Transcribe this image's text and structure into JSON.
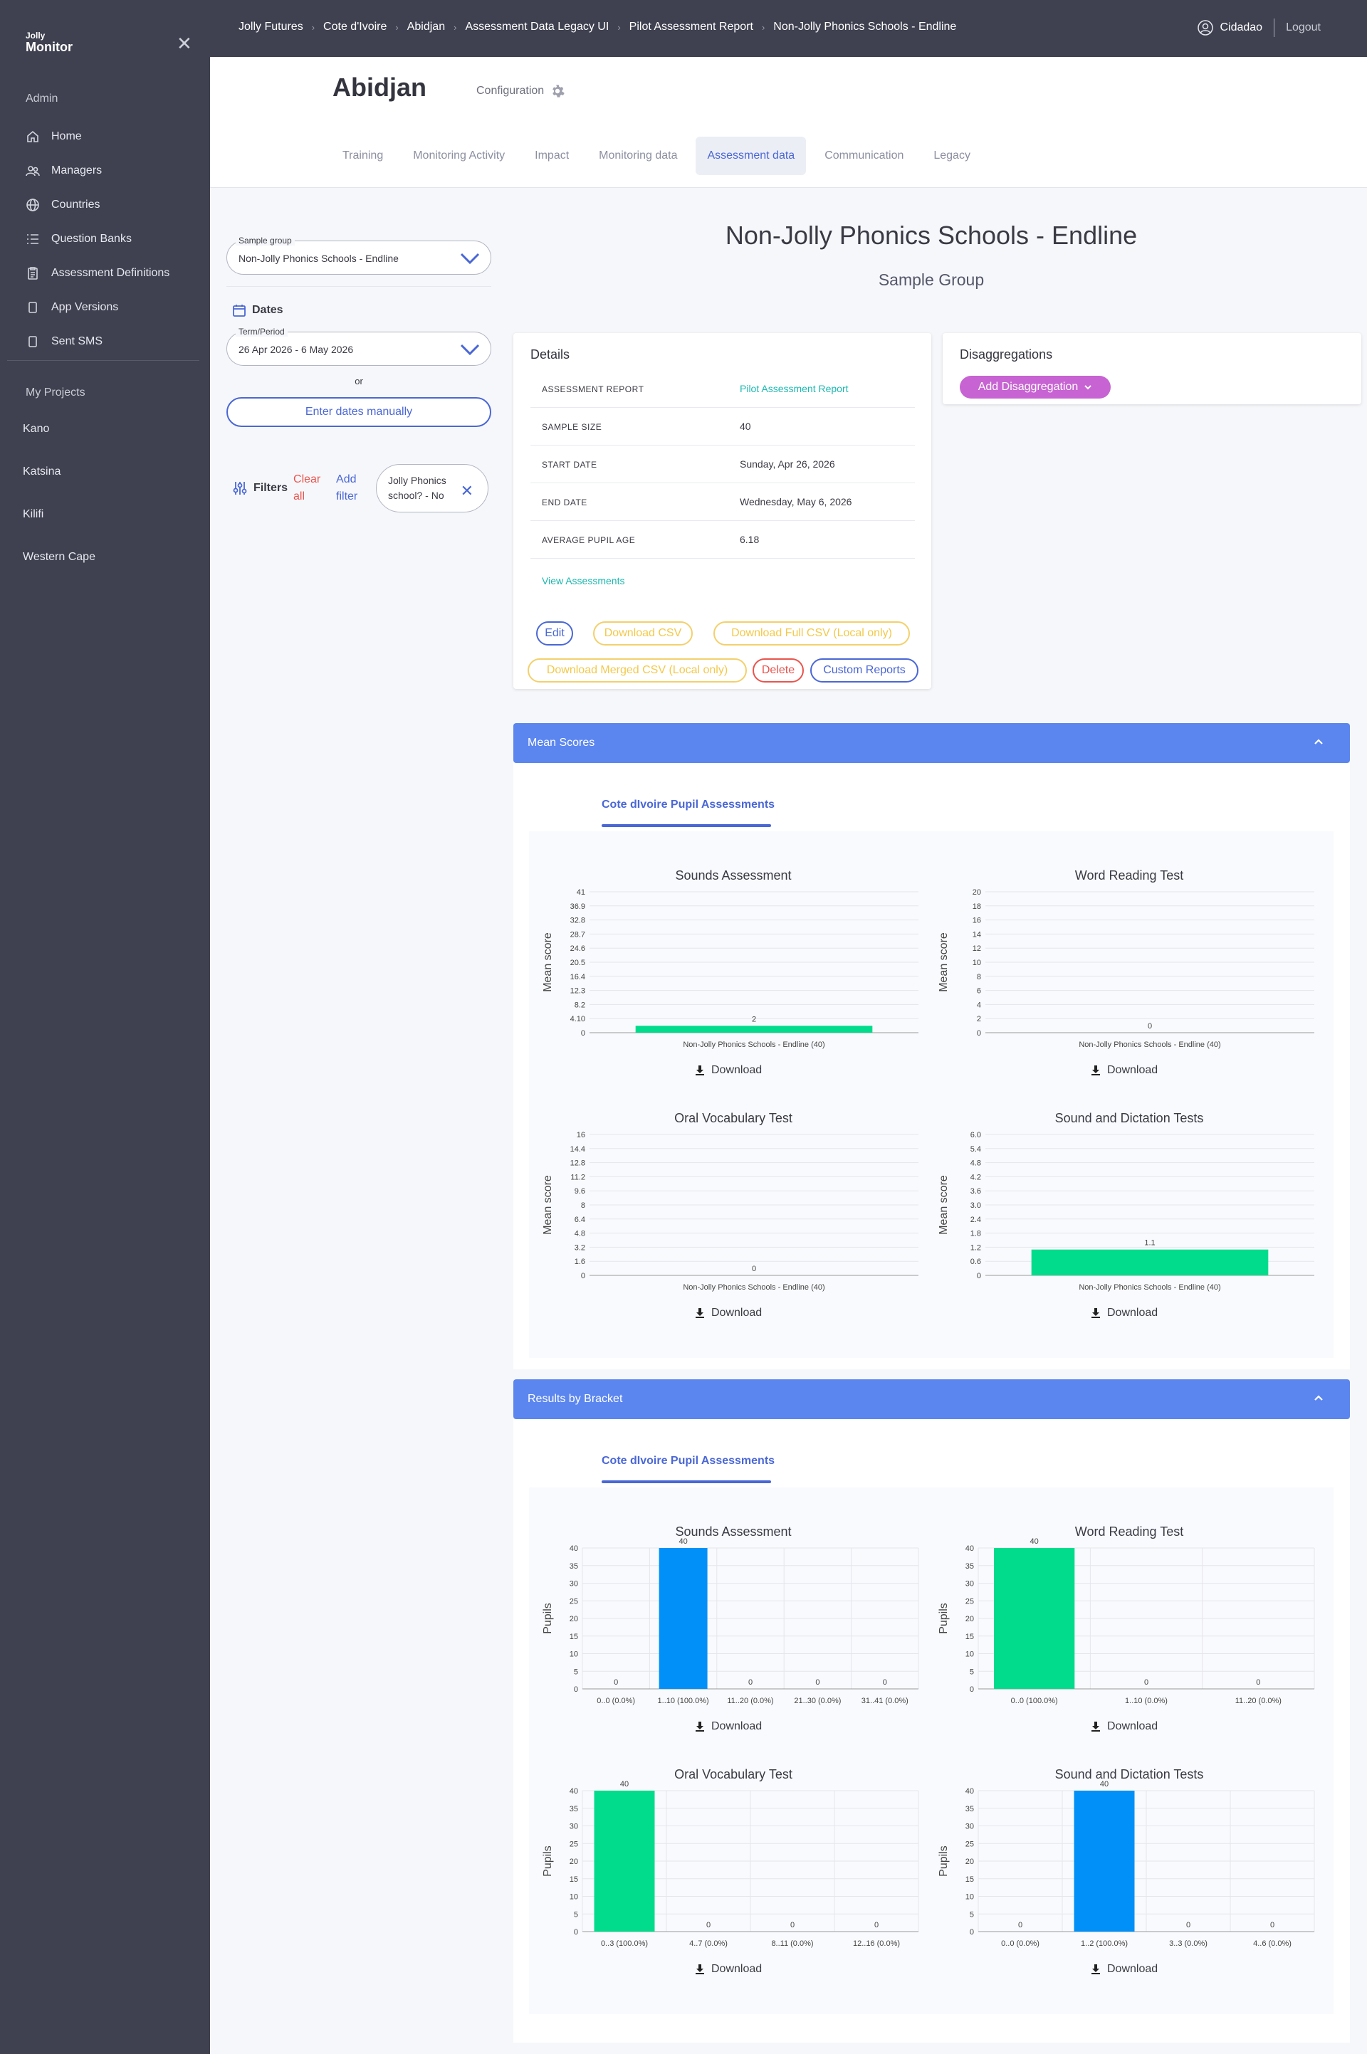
{
  "sidebar": {
    "logo_top": "Jolly",
    "logo_bottom": "Monitor",
    "admin_label": "Admin",
    "items": [
      {
        "label": "Home",
        "icon": "home-icon"
      },
      {
        "label": "Managers",
        "icon": "users-icon"
      },
      {
        "label": "Countries",
        "icon": "globe-icon"
      },
      {
        "label": "Question Banks",
        "icon": "list-icon"
      },
      {
        "label": "Assessment Definitions",
        "icon": "clipboard-icon"
      },
      {
        "label": "App Versions",
        "icon": "device-icon"
      },
      {
        "label": "Sent SMS",
        "icon": "device-icon"
      }
    ],
    "projects_label": "My Projects",
    "projects": [
      "Kano",
      "Katsina",
      "Kilifi",
      "Western Cape"
    ]
  },
  "topbar": {
    "breadcrumbs": [
      "Jolly Futures",
      "Cote d'Ivoire",
      "Abidjan",
      "Assessment Data Legacy UI",
      "Pilot Assessment Report",
      "Non-Jolly Phonics Schools - Endline"
    ],
    "user": "Cidadao",
    "logout": "Logout"
  },
  "header": {
    "city": "Abidjan",
    "config": "Configuration",
    "tabs": [
      "Training",
      "Monitoring Activity",
      "Impact",
      "Monitoring data",
      "Assessment data",
      "Communication",
      "Legacy"
    ],
    "active_tab": "Assessment data"
  },
  "filters": {
    "sample_group_label": "Sample group",
    "sample_group_value": "Non-Jolly Phonics Schools - Endline",
    "dates_title": "Dates",
    "term_label": "Term/Period",
    "term_value": "26 Apr 2026 - 6 May 2026",
    "or": "or",
    "manual_btn": "Enter dates manually",
    "filters_title": "Filters",
    "clear_all": "Clear all",
    "add_filter": "Add filter",
    "chip": "Jolly Phonics school? - No"
  },
  "main": {
    "title": "Non-Jolly Phonics Schools - Endline",
    "subtitle": "Sample Group"
  },
  "details": {
    "title": "Details",
    "rows": [
      {
        "key": "Assessment report",
        "value": "Pilot Assessment Report"
      },
      {
        "key": "Sample size",
        "value": "40"
      },
      {
        "key": "Start date",
        "value": "Sunday, Apr 26, 2026"
      },
      {
        "key": "End date",
        "value": "Wednesday, May 6, 2026"
      },
      {
        "key": "Average pupil age",
        "value": "6.18"
      }
    ],
    "view_assessments": "View Assessments",
    "buttons": {
      "edit": "Edit",
      "download_csv": "Download CSV",
      "download_full": "Download Full CSV (Local only)",
      "download_merged": "Download Merged CSV (Local only)",
      "delete": "Delete",
      "custom_reports": "Custom Reports"
    }
  },
  "disaggregations": {
    "title": "Disaggregations",
    "add_btn": "Add Disaggregation"
  },
  "mean_scores": {
    "bar_title": "Mean Scores",
    "subtab": "Cote dIvoire Pupil Assessments",
    "download": "Download"
  },
  "brackets": {
    "bar_title": "Results by Bracket",
    "subtab": "Cote dIvoire Pupil Assessments",
    "download": "Download"
  },
  "colors": {
    "green": "#00dc8c",
    "blue": "#0090f8",
    "accent": "#5b86f0",
    "sidebar": "#3f4150"
  },
  "chart_data": [
    {
      "type": "bar",
      "title": "Sounds Assessment",
      "ylabel": "Mean score",
      "categories": [
        "Non-Jolly Phonics Schools - Endline (40)"
      ],
      "values": [
        2
      ],
      "labels": [
        "2"
      ],
      "yticks": [
        "0",
        "4.10",
        "8.2",
        "12.3",
        "16.4",
        "20.5",
        "24.6",
        "28.7",
        "32.8",
        "36.9",
        "41"
      ],
      "ylim": [
        0,
        41
      ],
      "colors": [
        "#00dc8c"
      ]
    },
    {
      "type": "bar",
      "title": "Word Reading Test",
      "ylabel": "Mean score",
      "categories": [
        "Non-Jolly Phonics Schools - Endline (40)"
      ],
      "values": [
        0
      ],
      "labels": [
        "0"
      ],
      "yticks": [
        "0",
        "2",
        "4",
        "6",
        "8",
        "10",
        "12",
        "14",
        "16",
        "18",
        "20"
      ],
      "ylim": [
        0,
        20
      ],
      "colors": [
        "#00dc8c"
      ]
    },
    {
      "type": "bar",
      "title": "Oral Vocabulary Test",
      "ylabel": "Mean score",
      "categories": [
        "Non-Jolly Phonics Schools - Endline (40)"
      ],
      "values": [
        0
      ],
      "labels": [
        "0"
      ],
      "yticks": [
        "0",
        "1.6",
        "3.2",
        "4.8",
        "6.4",
        "8",
        "9.6",
        "11.2",
        "12.8",
        "14.4",
        "16"
      ],
      "ylim": [
        0,
        16
      ],
      "colors": [
        "#00dc8c"
      ]
    },
    {
      "type": "bar",
      "title": "Sound and Dictation Tests",
      "ylabel": "Mean score",
      "categories": [
        "Non-Jolly Phonics Schools - Endline (40)"
      ],
      "values": [
        1.1
      ],
      "labels": [
        "1.1"
      ],
      "yticks": [
        "0",
        "0.6",
        "1.2",
        "1.8",
        "2.4",
        "3.0",
        "3.6",
        "4.2",
        "4.8",
        "5.4",
        "6.0"
      ],
      "ylim": [
        0,
        6
      ],
      "colors": [
        "#00dc8c"
      ]
    },
    {
      "type": "bar",
      "title": "Sounds Assessment",
      "ylabel": "Pupils",
      "categories": [
        "0..0 (0.0%)",
        "1..10 (100.0%)",
        "11..20 (0.0%)",
        "21..30 (0.0%)",
        "31..41 (0.0%)"
      ],
      "values": [
        0,
        40,
        0,
        0,
        0
      ],
      "labels": [
        "0",
        "40",
        "0",
        "0",
        "0"
      ],
      "yticks": [
        "0",
        "5",
        "10",
        "15",
        "20",
        "25",
        "30",
        "35",
        "40"
      ],
      "ylim": [
        0,
        40
      ],
      "colors": [
        "#0090f8",
        "#0090f8",
        "#0090f8",
        "#0090f8",
        "#0090f8"
      ]
    },
    {
      "type": "bar",
      "title": "Word Reading Test",
      "ylabel": "Pupils",
      "categories": [
        "0..0 (100.0%)",
        "1..10 (0.0%)",
        "11..20 (0.0%)"
      ],
      "values": [
        40,
        0,
        0
      ],
      "labels": [
        "40",
        "0",
        "0"
      ],
      "yticks": [
        "0",
        "5",
        "10",
        "15",
        "20",
        "25",
        "30",
        "35",
        "40"
      ],
      "ylim": [
        0,
        40
      ],
      "colors": [
        "#00dc8c",
        "#00dc8c",
        "#00dc8c"
      ]
    },
    {
      "type": "bar",
      "title": "Oral Vocabulary Test",
      "ylabel": "Pupils",
      "categories": [
        "0..3 (100.0%)",
        "4..7 (0.0%)",
        "8..11 (0.0%)",
        "12..16 (0.0%)"
      ],
      "values": [
        40,
        0,
        0,
        0
      ],
      "labels": [
        "40",
        "0",
        "0",
        "0"
      ],
      "yticks": [
        "0",
        "5",
        "10",
        "15",
        "20",
        "25",
        "30",
        "35",
        "40"
      ],
      "ylim": [
        0,
        40
      ],
      "colors": [
        "#00dc8c",
        "#00dc8c",
        "#00dc8c",
        "#00dc8c"
      ]
    },
    {
      "type": "bar",
      "title": "Sound and Dictation Tests",
      "ylabel": "Pupils",
      "categories": [
        "0..0 (0.0%)",
        "1..2 (100.0%)",
        "3..3 (0.0%)",
        "4..6 (0.0%)"
      ],
      "values": [
        0,
        40,
        0,
        0
      ],
      "labels": [
        "0",
        "40",
        "0",
        "0"
      ],
      "yticks": [
        "0",
        "5",
        "10",
        "15",
        "20",
        "25",
        "30",
        "35",
        "40"
      ],
      "ylim": [
        0,
        40
      ],
      "colors": [
        "#0090f8",
        "#0090f8",
        "#0090f8",
        "#0090f8"
      ]
    }
  ]
}
